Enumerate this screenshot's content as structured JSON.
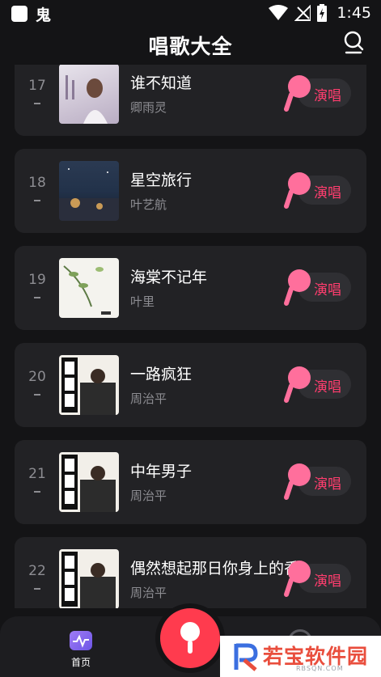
{
  "status_bar": {
    "time": "1:45",
    "app_glyph": "鬼"
  },
  "header": {
    "title": "唱歌大全"
  },
  "songs": [
    {
      "rank": "17",
      "title": "谁不知道",
      "artist": "卿雨灵",
      "action": "演唱"
    },
    {
      "rank": "18",
      "title": "星空旅行",
      "artist": "叶艺航",
      "action": "演唱"
    },
    {
      "rank": "19",
      "title": "海棠不记年",
      "artist": "叶里",
      "action": "演唱"
    },
    {
      "rank": "20",
      "title": "一路疯狂",
      "artist": "周治平",
      "action": "演唱"
    },
    {
      "rank": "21",
      "title": "中年男子",
      "artist": "周治平",
      "action": "演唱"
    },
    {
      "rank": "22",
      "title": "偶然想起那日你身上的香",
      "artist": "周治平",
      "action": "演唱"
    }
  ],
  "tabbar": {
    "home_label": "首页"
  },
  "watermark": {
    "text": "若宝软件园",
    "sub": "RBSQN.COM"
  },
  "colors": {
    "background": "#141416",
    "card": "#222225",
    "accent": "#ff3d6e",
    "center_button": "#ff3b4e"
  }
}
